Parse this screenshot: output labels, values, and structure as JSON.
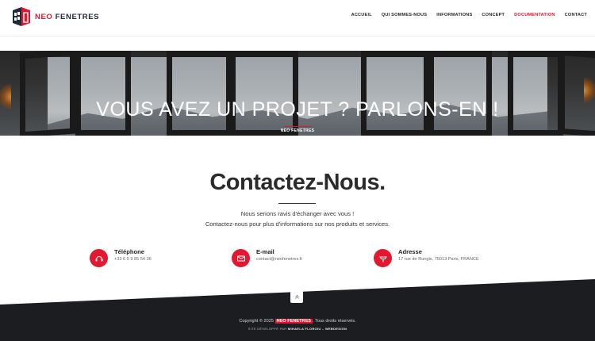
{
  "brand": {
    "neo": "NEO",
    "fenetres": "FENETRES"
  },
  "colors": {
    "accent": "#e3172f",
    "dark": "#1b1d21"
  },
  "nav": {
    "items": [
      {
        "label": "ACCUEIL"
      },
      {
        "label": "QUI SOMMES-NOUS"
      },
      {
        "label": "INFORMATIONS"
      },
      {
        "label": "CONCEPT"
      },
      {
        "label": "DOCUMENTATION",
        "active": true
      },
      {
        "label": "CONTACT"
      }
    ]
  },
  "hero": {
    "title": "VOUS AVEZ UN PROJET ? PARLONS-EN !",
    "breadcrumb": "NEO FENETRES"
  },
  "contact": {
    "title": "Contactez-Nous.",
    "intro_line1": "Nous serions ravis d'échanger avec vous !",
    "intro_line2": "Contactez-nous pour plus d'informations sur nos produits et services.",
    "items": [
      {
        "icon": "phone-icon",
        "label": "Téléphone",
        "value": "+33 6 5 9 85 54 36"
      },
      {
        "icon": "mail-icon",
        "label": "E-mail",
        "value": "contact@neofenetres.fr"
      },
      {
        "icon": "location-icon",
        "label": "Adresse",
        "value": "17 rue de Rungis, 75013 Paris, FRANCE"
      }
    ]
  },
  "footer": {
    "copyright_prefix": "Copyright © 2025",
    "copyright_brand": "NEO FENETRES",
    "copyright_suffix": ". Tous droits réservés.",
    "dev_prefix": "SITE DÉVELOPPÉ PAR",
    "dev_name": "MIHAELA FLOROIU – WEBDESIGN"
  }
}
